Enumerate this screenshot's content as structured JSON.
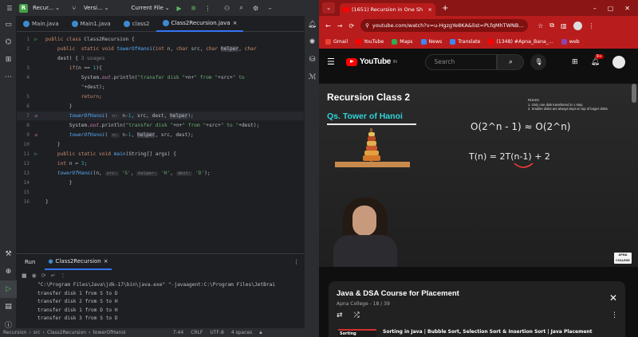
{
  "ide": {
    "project_badge": "R",
    "project_name": "Recur...",
    "vcs_label": "Versi...",
    "run_config": "Current File",
    "tabs": [
      {
        "label": "Main.java",
        "active": false
      },
      {
        "label": "Main1.java",
        "active": false
      },
      {
        "label": "class2",
        "active": false
      },
      {
        "label": "Class2Recursion.java",
        "active": true
      }
    ],
    "code_lines": [
      {
        "n": "1",
        "html": "<span class=\"kw\">public class</span> Class2Recursion {"
      },
      {
        "n": "2",
        "html": "    <span class=\"kw\">public  static void</span> <span class=\"fn\">towerOfHanoi</span>(<span class=\"kw\">int</span> n, <span class=\"kw\">char</span> src, <span class=\"kw\">char</span> <span class=\"hl\">helper</span>, <span class=\"kw\">char</span>"
      },
      {
        "n": "",
        "html": "    dest) { <span class=\"dim\">3 usages</span>"
      },
      {
        "n": "3",
        "html": "        <span class=\"kw\">if</span>(n == <span class=\"nm\">1</span>){"
      },
      {
        "n": "4",
        "html": "            System.<span class=\"sy\">out</span>.println(<span class=\"st\">\"transfer disk \"</span>+n+<span class=\"st\">\" from \"</span>+src+<span class=\"st\">\" to</span>"
      },
      {
        "n": "",
        "html": "            <span class=\"st\">\"</span>+dest);"
      },
      {
        "n": "5",
        "html": "            <span class=\"kw\">return</span>;"
      },
      {
        "n": "6",
        "html": "        }"
      },
      {
        "n": "7",
        "html": "        <span class=\"fi\">towerOfHanoi</span>( <span class=\"hint\">n:</span> n-<span class=\"nm\">1</span>, src, dest, <span class=\"hl\">helper</span>);"
      },
      {
        "n": "8",
        "html": "        System.<span class=\"sy\">out</span>.println(<span class=\"st\">\"transfer disk \"</span>+n+<span class=\"st\">\" from \"</span>+src+<span class=\"st\">\" to \"</span>+dest);"
      },
      {
        "n": "9",
        "html": "        <span class=\"fi\">towerOfHanoi</span>( <span class=\"hint\">n:</span> n-<span class=\"nm\">1</span>, <span class=\"hl\">helper</span>, src, dest);"
      },
      {
        "n": "10",
        "html": "    }"
      },
      {
        "n": "11",
        "html": "    <span class=\"kw\">public static void</span> <span class=\"fn\">main</span>(String[] args) {"
      },
      {
        "n": "12",
        "html": "    <span class=\"kw\">int</span> n = <span class=\"nm\">3</span>;"
      },
      {
        "n": "13",
        "html": "    <span class=\"fi\">towerOfHanoi</span>(n, <span class=\"hint\">src:</span> <span class=\"st\">'S'</span>, <span class=\"hint\">helper:</span> <span class=\"st\">'H'</span>, <span class=\"hint\">dest:</span> <span class=\"st\">'D'</span>);"
      },
      {
        "n": "14",
        "html": "        }"
      },
      {
        "n": "15",
        "html": "    "
      },
      {
        "n": "16",
        "html": "}"
      }
    ],
    "run_tab_label": "Run",
    "run_config_tab": "Class2Recursion",
    "console": [
      "\"C:\\Program Files\\Java\\jdk-17\\bin\\java.exe\" \"-javaagent:C:\\Program Files\\JetBrai",
      "transfer disk 1 from S to D",
      "transfer disk 2 from S to H",
      "transfer disk 1 from D to H",
      "transfer disk 3 from S to D"
    ],
    "status": {
      "crumbs": [
        "Recursion",
        "src",
        "Class2Recursion",
        "towerOfHanoi"
      ],
      "position": "7:44",
      "line_sep": "CRLF",
      "encoding": "UTF-8",
      "indent": "4 spaces"
    }
  },
  "browser": {
    "tab_title": "(1651) Recursion in One Sh",
    "url": "youtube.com/watch?v=u-HgzgYe8KA&list=PLfqMhTWNB...",
    "bookmarks": [
      {
        "label": "Gmail",
        "color": "#ea4335"
      },
      {
        "label": "YouTube",
        "color": "#ff0000"
      },
      {
        "label": "Maps",
        "color": "#34a853"
      },
      {
        "label": "News",
        "color": "#4285f4"
      },
      {
        "label": "Translate",
        "color": "#4285f4"
      },
      {
        "label": "(1348) #Apna_Bana_...",
        "color": "#ff0000"
      },
      {
        "label": "web",
        "color": "#8e44ad"
      }
    ],
    "youtube": {
      "logo_text": "YouTube",
      "logo_sup": "IN",
      "search_placeholder": "Search",
      "notif_count": "9+",
      "video": {
        "title": "Recursion Class 2",
        "subtitle": "Qs. Tower of Hanoi",
        "rules_header": "RULES",
        "rules": [
          "1. Only one disk transferred in 1 step",
          "2. Smaller disks are always kept on top of larger disks"
        ],
        "board_formula_1": "O(2^n - 1) ≈ O(2^n)",
        "board_formula_2": "T(n) = 2T(n-1) + 2",
        "channel_logo": "APNA COLLEGE"
      },
      "playlist": {
        "title": "Java & DSA Course for Placement",
        "meta": "Apna College - 18 / 39",
        "next_thumb": "Sorting",
        "next_title": "Sorting in Java | Bubble Sort, Selection Sort & Insertion Sort | Java Placement"
      }
    }
  },
  "colors": {
    "ide_bg": "#1e1f22",
    "browser_accent": "#b91c1c",
    "youtube_red": "#ff0000"
  }
}
